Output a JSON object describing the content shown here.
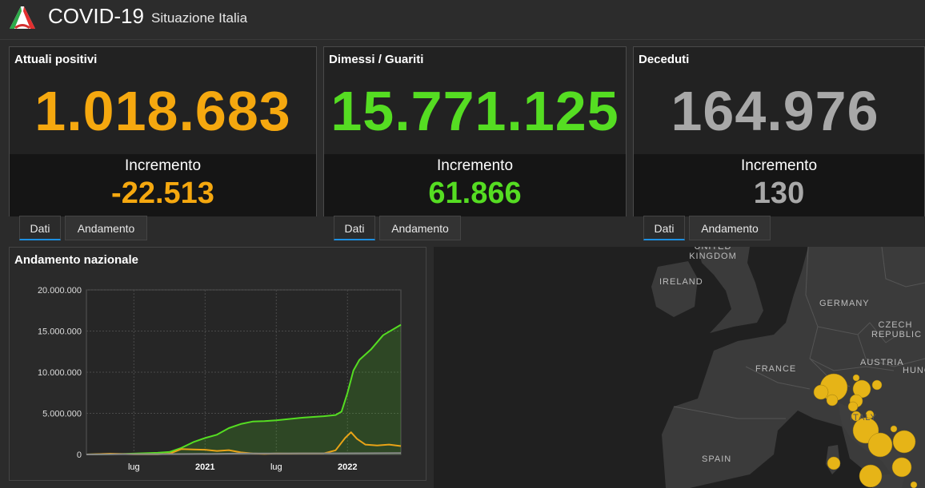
{
  "header": {
    "title": "COVID-19",
    "subtitle": "Situazione Italia",
    "logo_icon": "italy-flag-logo-icon"
  },
  "cards": [
    {
      "title": "Attuali positivi",
      "value": "1.018.683",
      "increment_label": "Incremento",
      "increment_value": "-22.513",
      "color": "#f5a80f"
    },
    {
      "title": "Dimessi / Guariti",
      "value": "15.771.125",
      "increment_label": "Incremento",
      "increment_value": "61.866",
      "color": "#55dd22"
    },
    {
      "title": "Deceduti",
      "value": "164.976",
      "increment_label": "Incremento",
      "increment_value": "130",
      "color": "#a8a8a8"
    }
  ],
  "tabs": [
    {
      "group": 1,
      "dati": "Dati",
      "andamento": "Andamento"
    },
    {
      "group": 2,
      "dati": "Dati",
      "andamento": "Andamento"
    },
    {
      "group": 3,
      "dati": "Dati",
      "andamento": "Andamento"
    }
  ],
  "chart_data": {
    "type": "line",
    "title": "Andamento nazionale",
    "x_tick_labels": [
      "lug",
      "2021",
      "lug",
      "2022"
    ],
    "y_tick_labels": [
      "20.000.000",
      "15.000.000",
      "10.000.000",
      "5.000.000",
      "0"
    ],
    "y_ticks": [
      20000000,
      15000000,
      10000000,
      5000000,
      0
    ],
    "ylim": [
      0,
      20000000
    ],
    "x_month_range": [
      0,
      26.5
    ],
    "x_tick_months": [
      4,
      10,
      16,
      22
    ],
    "grid": true,
    "series": [
      {
        "key": "guariti",
        "color": "#55dd22",
        "fill": true,
        "points": [
          [
            0,
            0
          ],
          [
            3,
            60000
          ],
          [
            6,
            200000
          ],
          [
            7,
            300000
          ],
          [
            8,
            800000
          ],
          [
            9,
            1500000
          ],
          [
            10,
            2000000
          ],
          [
            11,
            2400000
          ],
          [
            12,
            3200000
          ],
          [
            13,
            3700000
          ],
          [
            14,
            4000000
          ],
          [
            15,
            4050000
          ],
          [
            16,
            4150000
          ],
          [
            17,
            4300000
          ],
          [
            18,
            4450000
          ],
          [
            19,
            4550000
          ],
          [
            20,
            4650000
          ],
          [
            21,
            4800000
          ],
          [
            21.5,
            5200000
          ],
          [
            22,
            7500000
          ],
          [
            22.5,
            10200000
          ],
          [
            23,
            11500000
          ],
          [
            24,
            12800000
          ],
          [
            25,
            14500000
          ],
          [
            26.5,
            15771125
          ]
        ]
      },
      {
        "key": "positivi",
        "color": "#e8a317",
        "fill": false,
        "points": [
          [
            0,
            0
          ],
          [
            2,
            100000
          ],
          [
            4,
            30000
          ],
          [
            6,
            15000
          ],
          [
            7,
            100000
          ],
          [
            8,
            650000
          ],
          [
            9,
            600000
          ],
          [
            10,
            570000
          ],
          [
            11,
            430000
          ],
          [
            12,
            520000
          ],
          [
            13,
            250000
          ],
          [
            14,
            130000
          ],
          [
            15,
            80000
          ],
          [
            16,
            120000
          ],
          [
            17,
            110000
          ],
          [
            18,
            120000
          ],
          [
            20,
            130000
          ],
          [
            21,
            500000
          ],
          [
            21.8,
            2000000
          ],
          [
            22.3,
            2700000
          ],
          [
            22.8,
            1900000
          ],
          [
            23.5,
            1200000
          ],
          [
            24.5,
            1100000
          ],
          [
            25.5,
            1200000
          ],
          [
            26.5,
            1018683
          ]
        ]
      },
      {
        "key": "deceduti",
        "color": "#888888",
        "fill": false,
        "points": [
          [
            0,
            0
          ],
          [
            3,
            35000
          ],
          [
            6,
            36000
          ],
          [
            9,
            60000
          ],
          [
            11,
            80000
          ],
          [
            13,
            115000
          ],
          [
            16,
            127000
          ],
          [
            20,
            135000
          ],
          [
            23,
            145000
          ],
          [
            26.5,
            164976
          ]
        ]
      }
    ]
  },
  "map": {
    "labels": [
      "UNITED KINGDOM",
      "IRELAND",
      "GERMANY",
      "CZECH REPUBLIC",
      "FRANCE",
      "AUSTRIA",
      "HUNG",
      "ITALY",
      "SPAIN"
    ],
    "land_color": "#3d3d3d",
    "sea_color": "#1f1f1f",
    "marker_color": "#e6b417"
  }
}
